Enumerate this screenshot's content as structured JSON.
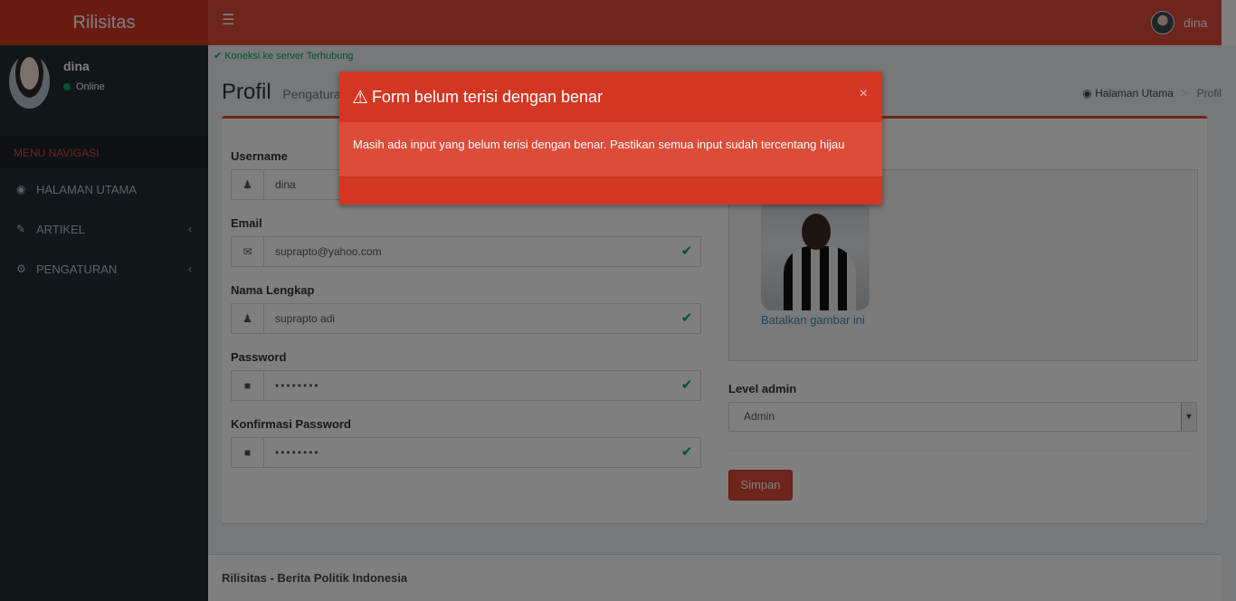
{
  "app": {
    "title": "Rilisitas"
  },
  "topbar": {
    "username": "dina"
  },
  "sidebar": {
    "user": {
      "name": "dina",
      "status": "Online"
    },
    "header": "MENU NAVIGASI",
    "items": [
      {
        "label": "HALAMAN UTAMA",
        "icon": "dashboard-icon"
      },
      {
        "label": "ARTIKEL",
        "icon": "edit-icon"
      },
      {
        "label": "PENGATURAN",
        "icon": "gears-icon"
      }
    ]
  },
  "content": {
    "connection": "Koneksi ke server Terhubung",
    "title": "Profil",
    "subtitle": "Pengaturan",
    "breadcrumb": {
      "home": "Halaman Utama",
      "current": "Profil"
    }
  },
  "form": {
    "username": {
      "label": "Username",
      "value": "dina"
    },
    "email": {
      "label": "Email",
      "value": "suprapto@yahoo.com"
    },
    "fullname": {
      "label": "Nama Lengkap",
      "value": "suprapto adi"
    },
    "password": {
      "label": "Password",
      "value": "••••••••"
    },
    "confirm": {
      "label": "Konfirmasi Password",
      "value": "••••••••"
    },
    "image_cancel": "Batalkan gambar ini",
    "level": {
      "label": "Level admin",
      "value": "Admin"
    },
    "save": "Simpan"
  },
  "modal": {
    "title": "Form belum terisi dengan benar",
    "close": "×",
    "body": "Masih ada input yang belum terisi dengan benar. Pastikan semua input sudah tercentang hijau"
  },
  "footer": {
    "text": "Rilisitas - Berita Politik Indonesia"
  },
  "colors": {
    "brand": "#dd4b39",
    "brand_dark": "#d33724",
    "sidebar": "#222d32",
    "success": "#00a65a"
  }
}
